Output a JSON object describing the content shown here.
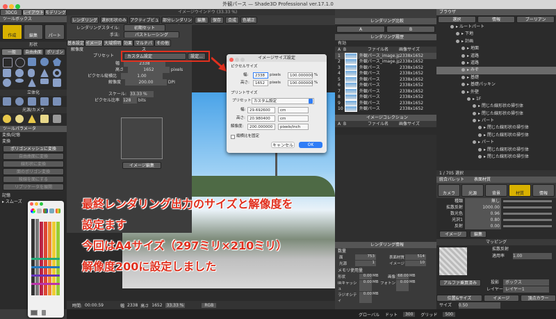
{
  "window": {
    "title": "外観パース — Shade3D Professional ver.17.1.0",
    "subtitle": "イメージウインドウ (33.33 %)"
  },
  "top_tabs": [
    "3DCG",
    "レイアウト",
    "モデリング"
  ],
  "toolbox": {
    "title": "ツールボックス",
    "section": "作成",
    "mode_buttons": [
      "作成",
      "編集",
      "パート"
    ],
    "tabs": [
      "一般",
      "自由曲面",
      "ポリゴン"
    ],
    "shape_section": "形状",
    "solid_section": "立体化",
    "light_section": "光源/カメラ",
    "params_title": "ツールパラメータ",
    "params_section": "変換/記憶",
    "params_buttons": [
      "ポリゴンメッシュに変換",
      "自由曲面に変換",
      "線形状に変換",
      "面のポリゴン変換",
      "稜線を面にする",
      "リプリケータを展開"
    ],
    "memory_section": "記憶",
    "memory_button": "スムーズ"
  },
  "image_window": {
    "toolbar": [
      "レンダリング",
      "選択形状のみ",
      "アクティブビュー",
      "部分レンダリング",
      "編集",
      "保存",
      "合成",
      "色補正"
    ],
    "render_style_label": "レンダリングスタイル:",
    "render_style_value": "初期セット",
    "method_label": "手法:",
    "method_value": "パストレーシング",
    "settings_tabs": [
      "基本設定",
      "イメージ",
      "大域照明",
      "効果",
      "マルチパス",
      "その他"
    ],
    "resolution_label": "解像度",
    "preset_label": "プリセット",
    "preset_value": "カスタム設定",
    "preset_button": "設定...",
    "fields": [
      {
        "label": "幅",
        "value": "2338",
        "unit": ""
      },
      {
        "label": "高さ",
        "value": "1652",
        "unit": "pixels"
      },
      {
        "label": "ピクセル縦横比",
        "value": "1.00",
        "unit": ""
      },
      {
        "label": "解像度",
        "value": "200.00",
        "unit": "DPI"
      }
    ],
    "scale_label": "スケール:",
    "scale_value": "33.33 %",
    "bits_label": "ピクセル比率",
    "bits_value": "128",
    "bits_unit": "bits",
    "crop_label": "イメージ編集",
    "status": {
      "time_label": "時間:",
      "time": "00:00:59",
      "w_label": "幅",
      "w": "2338",
      "h_label": "高さ",
      "h": "1652",
      "zoom": "33.33 %",
      "mode": "RGB"
    }
  },
  "dialog": {
    "title": "イメージサイズ設定",
    "pixel_section": "ピクセルサイズ",
    "w_label": "幅:",
    "w_value": "2338",
    "w_unit": "pixels",
    "w_pct": "100.000000",
    "w_pct_unit": "%",
    "h_label": "高さ:",
    "h_value": "1652",
    "h_unit": "pixels",
    "h_pct": "100.000000",
    "h_pct_unit": "%",
    "print_section": "プリントサイズ",
    "preset_label": "プリセット:",
    "preset_value": "カスタム設定",
    "pw_label": "幅:",
    "pw_value": "29.692600",
    "pw_unit": "cm",
    "ph_label": "高さ:",
    "ph_value": "20.980400",
    "ph_unit": "cm",
    "res_label": "解像度:",
    "res_value": "200.000000",
    "res_unit": "pixels/inch",
    "keep_ratio": "縦横比を固定",
    "cancel": "キャンセル",
    "ok": "OK"
  },
  "annotation": {
    "line1": "最終レンダリング出力のサイズと解像度を",
    "line2": "設定ます",
    "line3": "今回はA4サイズ（297ミリ×210ミリ）",
    "line4": "解像度200に設定しました",
    "color": "#e0301e"
  },
  "render_history": {
    "title": "レンダリング比較",
    "sub_title": "レンダリング履歴",
    "header": "有効",
    "columns": [
      "A",
      "B",
      "",
      "ファイル名",
      "画像サイズ"
    ],
    "rows": [
      {
        "n": "1",
        "name": "外観パース_image.jpg",
        "size": "2338x1652"
      },
      {
        "n": "2",
        "name": "外観パース_image.jpg",
        "size": "2338x1652"
      },
      {
        "n": "3",
        "name": "外観パース",
        "size": "2338x1652"
      },
      {
        "n": "4",
        "name": "外観パース",
        "size": "2338x1652"
      },
      {
        "n": "5",
        "name": "外観パース",
        "size": "2338x1652"
      },
      {
        "n": "6",
        "name": "外観パース",
        "size": "2338x1652"
      },
      {
        "n": "7",
        "name": "外観パース",
        "size": "2338x1652"
      },
      {
        "n": "8",
        "name": "外観パース",
        "size": "2338x1652"
      },
      {
        "n": "9",
        "name": "外観パース",
        "size": "2338x1652"
      },
      {
        "n": "10",
        "name": "外観パース",
        "size": "2338x1652"
      }
    ],
    "collection_title": "イメージコレクション",
    "collection_columns": [
      "A",
      "B",
      "",
      "ファイル名",
      "画像サイズ"
    ]
  },
  "render_info": {
    "title": "レンダリング情報",
    "section1": "数量",
    "rows1": [
      [
        "面",
        "753"
      ],
      [
        "光源",
        "1"
      ]
    ],
    "rows1b": [
      [
        "表面材質",
        "514"
      ],
      [
        "イメージ",
        "10"
      ]
    ],
    "section2": "メモリ使用量",
    "rows2": [
      [
        "形状",
        "0.00",
        "MB"
      ],
      [
        "IRキャッシュ",
        "0.00",
        "MB"
      ],
      [
        "ラジオシティ",
        "0.00",
        "MB"
      ]
    ],
    "rows2b": [
      [
        "画像",
        "68.00",
        "MB"
      ],
      [
        "フォトン",
        "0.00",
        "MB"
      ]
    ]
  },
  "browser": {
    "title": "ブラウザ",
    "tabs": [
      "選択",
      "情報",
      "ブーリアン"
    ],
    "items": [
      {
        "label": "ルートパート",
        "indent": 0
      },
      {
        "label": "下地",
        "indent": 1
      },
      {
        "label": "計画",
        "indent": 1
      },
      {
        "label": "地面",
        "indent": 2
      },
      {
        "label": "道路",
        "indent": 2
      },
      {
        "label": "道路",
        "indent": 2
      },
      {
        "label": "みぞ",
        "indent": 2
      },
      {
        "label": "基礎",
        "indent": 2
      },
      {
        "label": "基礎パッキン",
        "indent": 2
      },
      {
        "label": "外壁",
        "indent": 2
      },
      {
        "label": "1F",
        "indent": 3
      },
      {
        "label": "閉じた線形状の掃引体",
        "indent": 4
      },
      {
        "label": "閉じた線形状の掃引体",
        "indent": 4
      },
      {
        "label": "パート",
        "indent": 4
      },
      {
        "label": "閉じた線形状の掃引体",
        "indent": 5
      },
      {
        "label": "閉じた線形状の掃引体",
        "indent": 5
      },
      {
        "label": "パート",
        "indent": 4
      },
      {
        "label": "閉じた線形状の掃引体",
        "indent": 5
      },
      {
        "label": "閉じた線形状の掃引体",
        "indent": 5
      }
    ],
    "count": "1 / 705 選択"
  },
  "palette": {
    "title": "統合パレット",
    "sub": "表面材質",
    "tabs": [
      "カメラ",
      "光源",
      "背景",
      "材質",
      "情報"
    ],
    "material_rows": [
      {
        "label": "種類",
        "value": "無し"
      },
      {
        "label": "拡散反射",
        "value": "1000.00"
      },
      {
        "label": "数光色",
        "value": "0.96"
      },
      {
        "label": "光沢1",
        "value": "0.80"
      },
      {
        "label": "反射",
        "value": "0.00"
      }
    ],
    "image_label": "イメージ",
    "edit_label": "編集",
    "mapping_label": "マッピング",
    "mapping_rows": [
      "拡散反射",
      "適用率",
      "1.00"
    ],
    "alpha_label": "アルファ乗算済み",
    "projection_label": "投影",
    "projection_value": "ボックス",
    "layer_label": "レイヤー",
    "layer_value": "レイヤー1",
    "size_label": "サイズ",
    "size_value": "0.50",
    "size_tabs": [
      "位置&サイズ",
      "イメージ",
      "頂点カラー"
    ],
    "bottom": "位置"
  },
  "statusbar": {
    "global_label": "グローバル",
    "dot_label": "ドット",
    "dot_value": "300",
    "grid_label": "グリッド",
    "grid_value": "500"
  },
  "small_window": {
    "title": ""
  }
}
